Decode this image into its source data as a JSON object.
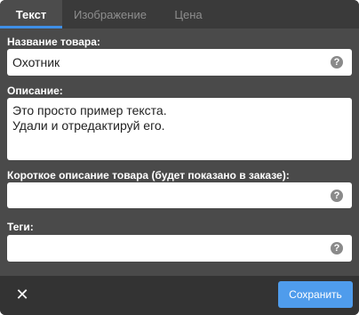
{
  "tabs": [
    {
      "label": "Текст",
      "active": true
    },
    {
      "label": "Изображение",
      "active": false
    },
    {
      "label": "Цена",
      "active": false
    }
  ],
  "fields": {
    "name": {
      "label": "Название товара:",
      "value": "Охотник"
    },
    "description": {
      "label": "Описание:",
      "value": "Это просто пример текста.\nУдали и отредактируй его."
    },
    "short_description": {
      "label": "Короткое описание товара (будет показано в заказе):",
      "value": ""
    },
    "tags": {
      "label": "Теги:",
      "value": ""
    }
  },
  "icons": {
    "help": "?",
    "close": "✕"
  },
  "footer": {
    "save_label": "Сохранить"
  },
  "colors": {
    "accent": "#3f8fe6",
    "save_button": "#4f9cec",
    "panel": "#4a4a4a"
  }
}
